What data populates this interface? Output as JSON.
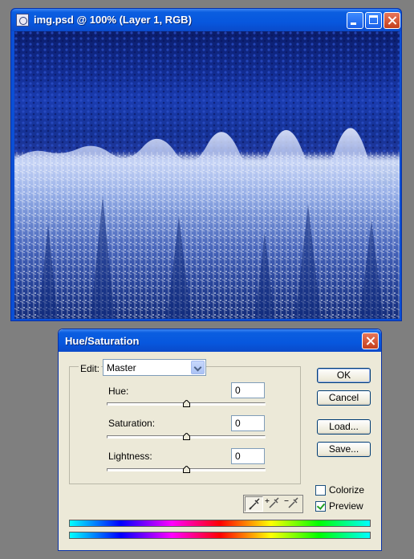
{
  "document_window": {
    "title": "img.psd @ 100% (Layer 1, RGB)"
  },
  "dialog": {
    "title": "Hue/Saturation",
    "edit_label": "Edit:",
    "edit_value": "Master",
    "sliders": [
      {
        "label": "Hue:",
        "value": "0",
        "range": [
          -180,
          180
        ],
        "current": 0
      },
      {
        "label": "Saturation:",
        "value": "0",
        "range": [
          -100,
          100
        ],
        "current": 0
      },
      {
        "label": "Lightness:",
        "value": "0",
        "range": [
          -100,
          100
        ],
        "current": 0
      }
    ],
    "buttons": {
      "ok": "OK",
      "cancel": "Cancel",
      "load": "Load...",
      "save": "Save..."
    },
    "checkboxes": {
      "colorize": {
        "label": "Colorize",
        "checked": false
      },
      "preview": {
        "label": "Preview",
        "checked": true
      }
    },
    "eyedroppers": [
      "eyedropper-icon",
      "eyedropper-plus-icon",
      "eyedropper-minus-icon"
    ]
  },
  "colors": {
    "titlebar": "#0b5ee0",
    "dialog_bg": "#ece9d8",
    "close_button": "#c43f1c"
  }
}
